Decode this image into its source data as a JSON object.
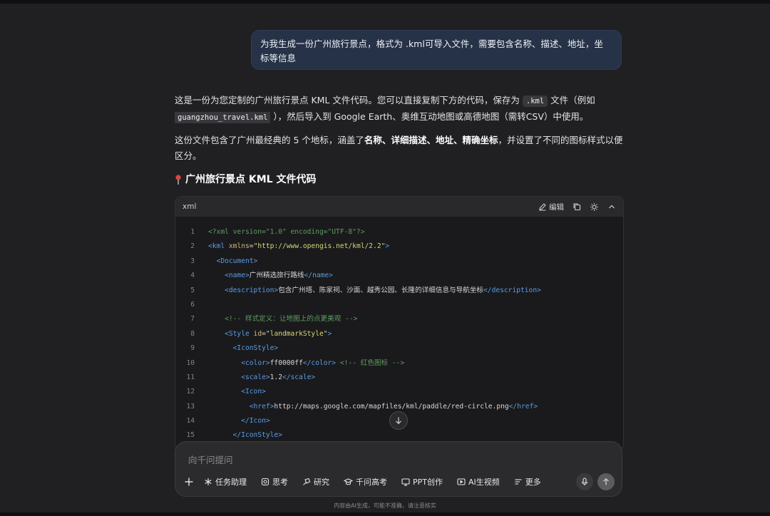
{
  "user_message": "为我生成一份广州旅行景点，格式为 .kml可导入文件，需要包含名称、描述、地址，坐标等信息",
  "response": {
    "p1": {
      "a": "这是一份为您定制的广州旅行景点 KML 文件代码。您可以直接复制下方的代码，保存为 ",
      "code1": ".kml",
      "b": " 文件（例如 ",
      "code2": "guangzhou_travel.kml",
      "c": " ），然后导入到 Google Earth、奥维互动地图或高德地图（需转CSV）中使用。"
    },
    "p2": {
      "a": "这份文件包含了广州最经典的 5 个地标，涵盖了",
      "b1": "名称",
      "sep1": "、",
      "b2": "详细描述",
      "sep2": "、",
      "b3": "地址",
      "sep3": "、",
      "b4": "精确坐标",
      "c": "，并设置了不同的图标样式以便区分。"
    },
    "heading": "广州旅行景点 KML 文件代码"
  },
  "code_block": {
    "language": "xml",
    "edit_label": "编辑",
    "lines": [
      {
        "n": "1",
        "parts": [
          [
            "c",
            "<?xml version=\"1.0\" encoding=\"UTF-8\"?>"
          ]
        ]
      },
      {
        "n": "2",
        "parts": [
          [
            "t",
            "<kml "
          ],
          [
            "a",
            "xmlns"
          ],
          [
            "txt",
            "="
          ],
          [
            "s",
            "\"http://www.opengis.net/kml/2.2\""
          ],
          [
            "t",
            ">"
          ]
        ]
      },
      {
        "n": "3",
        "parts": [
          [
            "txt",
            "  "
          ],
          [
            "t",
            "<Document>"
          ]
        ]
      },
      {
        "n": "4",
        "parts": [
          [
            "txt",
            "    "
          ],
          [
            "t",
            "<name>"
          ],
          [
            "txt",
            "广州精选旅行路线"
          ],
          [
            "t",
            "</name>"
          ]
        ]
      },
      {
        "n": "5",
        "parts": [
          [
            "txt",
            "    "
          ],
          [
            "t",
            "<description>"
          ],
          [
            "txt",
            "包含广州塔、陈家祠、沙面、越秀公园、长隆的详细信息与导航坐标"
          ],
          [
            "t",
            "</description>"
          ]
        ]
      },
      {
        "n": "6",
        "parts": []
      },
      {
        "n": "7",
        "parts": [
          [
            "txt",
            "    "
          ],
          [
            "c",
            "<!-- 样式定义：让地图上的点更美观 -->"
          ]
        ]
      },
      {
        "n": "8",
        "parts": [
          [
            "txt",
            "    "
          ],
          [
            "t",
            "<Style "
          ],
          [
            "a",
            "id"
          ],
          [
            "txt",
            "="
          ],
          [
            "s",
            "\"landmarkStyle\""
          ],
          [
            "t",
            ">"
          ]
        ]
      },
      {
        "n": "9",
        "parts": [
          [
            "txt",
            "      "
          ],
          [
            "t",
            "<IconStyle>"
          ]
        ]
      },
      {
        "n": "10",
        "parts": [
          [
            "txt",
            "        "
          ],
          [
            "t",
            "<color>"
          ],
          [
            "txt",
            "ff0000ff"
          ],
          [
            "t",
            "</color>"
          ],
          [
            "txt",
            " "
          ],
          [
            "c",
            "<!-- 红色图标 -->"
          ]
        ]
      },
      {
        "n": "11",
        "parts": [
          [
            "txt",
            "        "
          ],
          [
            "t",
            "<scale>"
          ],
          [
            "txt",
            "1.2"
          ],
          [
            "t",
            "</scale>"
          ]
        ]
      },
      {
        "n": "12",
        "parts": [
          [
            "txt",
            "        "
          ],
          [
            "t",
            "<Icon>"
          ]
        ]
      },
      {
        "n": "13",
        "parts": [
          [
            "txt",
            "          "
          ],
          [
            "t",
            "<href>"
          ],
          [
            "txt",
            "http://maps.google.com/mapfiles/kml/paddle/red-circle.png"
          ],
          [
            "t",
            "</href>"
          ]
        ]
      },
      {
        "n": "14",
        "parts": [
          [
            "txt",
            "        "
          ],
          [
            "t",
            "</Icon>"
          ]
        ]
      },
      {
        "n": "15",
        "parts": [
          [
            "txt",
            "      "
          ],
          [
            "t",
            "</IconStyle>"
          ]
        ]
      }
    ]
  },
  "composer": {
    "placeholder": "向千问提问",
    "tools": [
      {
        "icon": "asterisk-icon",
        "label": "任务助理"
      },
      {
        "icon": "think-icon",
        "label": "思考"
      },
      {
        "icon": "research-icon",
        "label": "研究"
      },
      {
        "icon": "graduation-cap-icon",
        "label": "千问高考"
      },
      {
        "icon": "ppt-icon",
        "label": "PPT创作"
      },
      {
        "icon": "video-icon",
        "label": "AI生视频"
      },
      {
        "icon": "more-list-icon",
        "label": "更多"
      }
    ]
  },
  "disclaimer": "内容由AI生成，可能不准确，请注意核实",
  "colors": {
    "user_bubble": "#263247",
    "tag": "#5a9ce6",
    "attr": "#d6b77a",
    "string": "#d7d777",
    "comment": "#5d9d62"
  }
}
